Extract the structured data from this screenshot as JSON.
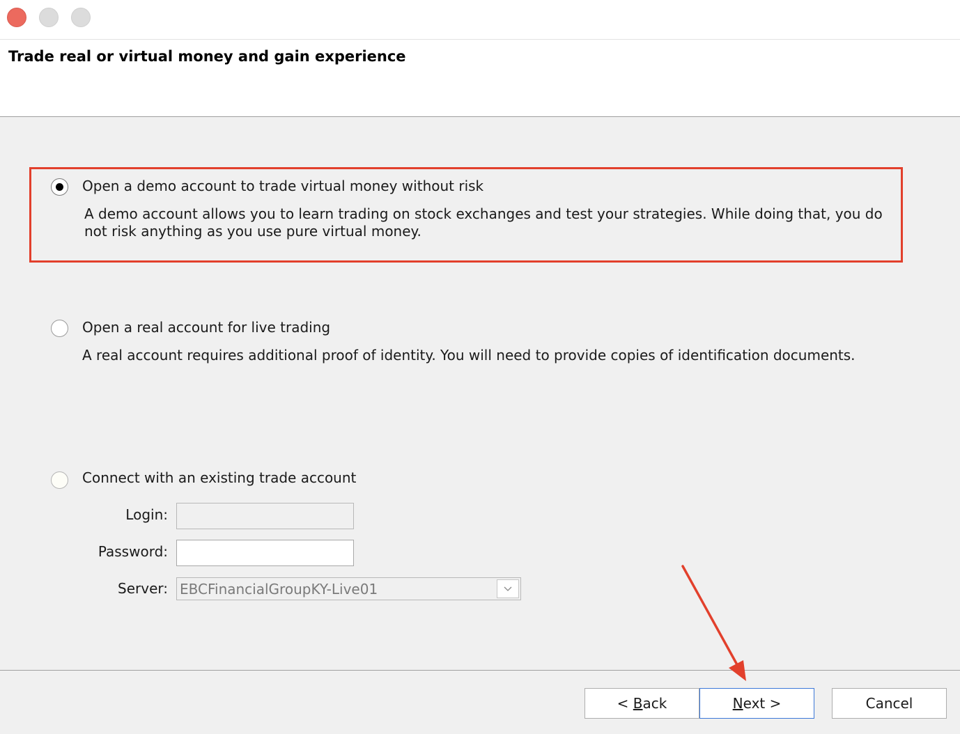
{
  "header": {
    "title": "Trade real or virtual money and gain experience"
  },
  "options": {
    "demo": {
      "label": "Open a demo account to trade virtual money without risk",
      "description": "A demo account allows you to learn trading on stock exchanges and test your strategies. While doing that, you do not risk anything as you use pure virtual money.",
      "selected": true
    },
    "real": {
      "label": "Open a real account for live trading",
      "description": "A real account requires additional proof of identity. You will need to provide copies of identification documents.",
      "selected": false
    },
    "existing": {
      "label": "Connect with an existing trade account",
      "selected": false
    }
  },
  "form": {
    "login_label": "Login:",
    "login_value": "",
    "password_label": "Password:",
    "password_value": "",
    "server_label": "Server:",
    "server_value": "EBCFinancialGroupKY-Live01"
  },
  "buttons": {
    "back_prefix": "< ",
    "back_key": "B",
    "back_rest": "ack",
    "next_key": "N",
    "next_rest": "ext >",
    "cancel": "Cancel"
  },
  "colors": {
    "highlight": "#e2402c",
    "close_button": "#ec6a5e"
  },
  "icons": {
    "close": "close-icon",
    "minimize": "minimize-icon",
    "maximize": "maximize-icon",
    "dropdown": "chevron-down-icon",
    "annotation": "arrow-annotation-icon"
  }
}
